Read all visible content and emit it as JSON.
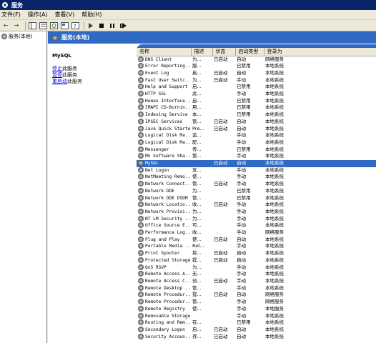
{
  "window": {
    "title": "服务"
  },
  "menu": [
    "文件(F)",
    "操作(A)",
    "查看(V)",
    "帮助(H)"
  ],
  "tree": {
    "root_label": "服务(本地)"
  },
  "panel": {
    "header": "服务(本地)"
  },
  "description": {
    "service_name": "MySQL",
    "links": [
      {
        "link": "停止",
        "rest": "此服务"
      },
      {
        "link": "暂停",
        "rest": "此服务"
      },
      {
        "link": "重启动",
        "rest": "此服务"
      }
    ]
  },
  "columns": [
    "名称",
    "描述",
    "状态",
    "启动类型",
    "登录为"
  ],
  "services": [
    [
      "DNS Client",
      "为...",
      "已启动",
      "自动",
      "网络服务"
    ],
    [
      "Error Reporting...",
      "服...",
      "",
      "已禁用",
      "本地系统"
    ],
    [
      "Event Log",
      "启...",
      "已启动",
      "自动",
      "本地系统"
    ],
    [
      "Fast User Switc...",
      "为...",
      "已启动",
      "手动",
      "本地系统"
    ],
    [
      "Help and Support",
      "启...",
      "",
      "已禁用",
      "本地系统"
    ],
    [
      "HTTP SSL",
      "此...",
      "",
      "手动",
      "本地系统"
    ],
    [
      "Human Interface...",
      "启...",
      "",
      "已禁用",
      "本地系统"
    ],
    [
      "IMAPI CD-Burnin...",
      "用...",
      "",
      "已禁用",
      "本地系统"
    ],
    [
      "Indexing Service",
      "本...",
      "",
      "已禁用",
      "本地系统"
    ],
    [
      "IPSEC Services",
      "管...",
      "已启动",
      "自动",
      "本地系统"
    ],
    [
      "Java Quick Starter",
      "Pre...",
      "已启动",
      "自动",
      "本地系统"
    ],
    [
      "Logical Disk Ma...",
      "监...",
      "",
      "手动",
      "本地系统"
    ],
    [
      "Logical Disk Ma...",
      "配...",
      "",
      "手动",
      "本地系统"
    ],
    [
      "Messenger",
      "传...",
      "",
      "已禁用",
      "本地系统"
    ],
    [
      "MS Software Sha...",
      "管...",
      "",
      "手动",
      "本地系统"
    ],
    [
      "MySQL",
      "",
      "已启动",
      "自动",
      "本地系统"
    ],
    [
      "Net Logon",
      "支...",
      "",
      "手动",
      "本地系统"
    ],
    [
      "NetMeeting Remo...",
      "使...",
      "",
      "手动",
      "本地系统"
    ],
    [
      "Network Connect...",
      "管...",
      "已启动",
      "手动",
      "本地系统"
    ],
    [
      "Network DDE",
      "为...",
      "",
      "已禁用",
      "本地系统"
    ],
    [
      "Network DDE DSDM",
      "管...",
      "",
      "已禁用",
      "本地系统"
    ],
    [
      "Network Locatio...",
      "收...",
      "已启动",
      "手动",
      "本地系统"
    ],
    [
      "Network Provisi...",
      "为...",
      "",
      "手动",
      "本地系统"
    ],
    [
      "NT LM Security ...",
      "为...",
      "",
      "手动",
      "本地系统"
    ],
    [
      "Office Source E...",
      "可...",
      "",
      "手动",
      "本地系统"
    ],
    [
      "Performance Log...",
      "收...",
      "",
      "手动",
      "网络服务"
    ],
    [
      "Plug and Play",
      "使...",
      "已启动",
      "自动",
      "本地系统"
    ],
    [
      "Portable Media ...",
      "Ret...",
      "",
      "手动",
      "本地系统"
    ],
    [
      "Print Spooler",
      "将...",
      "已启动",
      "自动",
      "本地系统"
    ],
    [
      "Protected Storage",
      "提...",
      "已启动",
      "自动",
      "本地系统"
    ],
    [
      "QoS RSVP",
      "为...",
      "",
      "手动",
      "本地系统"
    ],
    [
      "Remote Access A...",
      "无...",
      "",
      "手动",
      "本地系统"
    ],
    [
      "Remote Access C...",
      "创...",
      "已启动",
      "手动",
      "本地系统"
    ],
    [
      "Remote Desktop ...",
      "管...",
      "",
      "手动",
      "本地系统"
    ],
    [
      "Remote Procedur...",
      "提...",
      "已启动",
      "自动",
      "网络服务"
    ],
    [
      "Remote Procedur...",
      "管...",
      "",
      "手动",
      "网络服务"
    ],
    [
      "Remote Registry",
      "使...",
      "",
      "手动",
      "本地服务"
    ],
    [
      "Removable Storage",
      "",
      "",
      "手动",
      "本地系统"
    ],
    [
      "Routing and Rem...",
      "在...",
      "",
      "已禁用",
      "本地系统"
    ],
    [
      "Secondary Logon",
      "启...",
      "已启动",
      "自动",
      "本地系统"
    ],
    [
      "Security Accoun...",
      "存...",
      "已启动",
      "自动",
      "本地系统"
    ]
  ],
  "selected_index": 15
}
